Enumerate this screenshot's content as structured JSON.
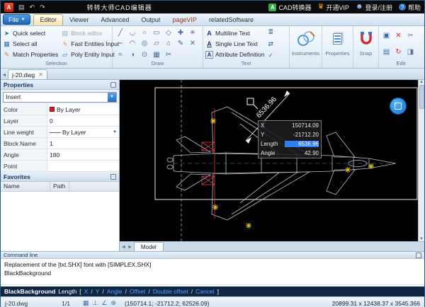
{
  "colors": {
    "accent": "#1e7ad4",
    "canvas_bg": "#000000",
    "highlight": "#2f7df5",
    "wire": "#b6c0ca",
    "detail_red": "#d84040",
    "detail_yellow": "#e6c22a"
  },
  "titlebar": {
    "logo": "A",
    "icons": [
      "▤",
      "↶",
      "↷"
    ],
    "title": "转转大师CAD编辑器",
    "right": [
      {
        "label": "CAD转换器"
      },
      {
        "label": "开通VIP"
      },
      {
        "label": "登录/注册"
      },
      {
        "label": "帮助"
      }
    ]
  },
  "tabs": {
    "file": "File",
    "items": [
      "Editor",
      "Viewer",
      "Advanced",
      "Output",
      "pageVIP",
      "relatedSoftware"
    ],
    "active": "Editor"
  },
  "ribbon": {
    "selection": {
      "label": "Selection",
      "items": [
        {
          "label": "Quick select",
          "glyph": "➤"
        },
        {
          "label": "Select all",
          "glyph": "▦"
        },
        {
          "label": "Match Properties",
          "glyph": "✎"
        },
        {
          "label": "Block editor",
          "glyph": "▤"
        },
        {
          "label": "Fast Entities Input",
          "glyph": "ϟ"
        },
        {
          "label": "Poly Entity Input",
          "glyph": "▱"
        }
      ]
    },
    "draw": {
      "label": "Draw",
      "grid": [
        [
          "╱",
          "◡",
          "○",
          "▭",
          "◇",
          "✚",
          "✳"
        ],
        [
          "∼",
          "◠",
          "◎",
          "▱",
          "⌂",
          "✎",
          "✕"
        ],
        [
          "≈",
          "◑",
          "⊙",
          "▦",
          "✂"
        ]
      ]
    },
    "text": {
      "label": "Text",
      "items": [
        {
          "label": "Multiline Text"
        },
        {
          "label": "Single Line Text"
        },
        {
          "label": "Attribute Definition"
        }
      ],
      "side_icons": [
        "≣",
        "⇄",
        "✓"
      ]
    },
    "instruments": {
      "label": "Instruments"
    },
    "properties": {
      "label": "Properties"
    },
    "snap": {
      "label": "Snap"
    },
    "edit": {
      "label": "Edit",
      "grid": [
        [
          "▣",
          "✕",
          "✂"
        ],
        [
          "▤",
          "↻",
          "◨"
        ]
      ]
    }
  },
  "doc_tab": {
    "name": "j-20.dwg",
    "close": "✕"
  },
  "properties_panel": {
    "title": "Properties",
    "selector": "Insert",
    "rows": [
      {
        "label": "Color",
        "value": "By Layer"
      },
      {
        "label": "Layer",
        "value": "0"
      },
      {
        "label": "Line weight",
        "value": "By Layer"
      },
      {
        "label": "Block Name",
        "value": "1"
      },
      {
        "label": "Angle",
        "value": "180"
      },
      {
        "label": "Point",
        "value": ""
      }
    ]
  },
  "favorites_panel": {
    "title": "Favorites",
    "columns": [
      "Name",
      "Path"
    ]
  },
  "canvas": {
    "dimension_label": "6536.96",
    "tooltip": {
      "rows": [
        {
          "label": "X",
          "value": "150714.09"
        },
        {
          "label": "Y",
          "value": "-21712.20"
        },
        {
          "label": "Length",
          "value": "6536.96"
        },
        {
          "label": "Angle",
          "value": "42.90"
        }
      ]
    },
    "model_tab": "Model"
  },
  "command_line": {
    "title": "Command line",
    "lines": [
      "Replacement of the [txt.SHX] font with [SIMPLEX.SHX]",
      "BlackBackground"
    ],
    "prompt": {
      "name": "BlackBackground",
      "verb": "Length",
      "bracket_open": "[",
      "bracket_close": "]",
      "options": [
        "X",
        "Y",
        "Angle",
        "Offset",
        "Double offset",
        "Cancel"
      ]
    }
  },
  "status_bar": {
    "file": "j-20.dwg",
    "page": "1/1",
    "icons": [
      "▦",
      "⊥",
      "∠",
      "⊕"
    ],
    "coords": "(150714.1; -21712.2; 62526.09)",
    "dims": "20899.31 x 12438.37 x 3545.366"
  }
}
